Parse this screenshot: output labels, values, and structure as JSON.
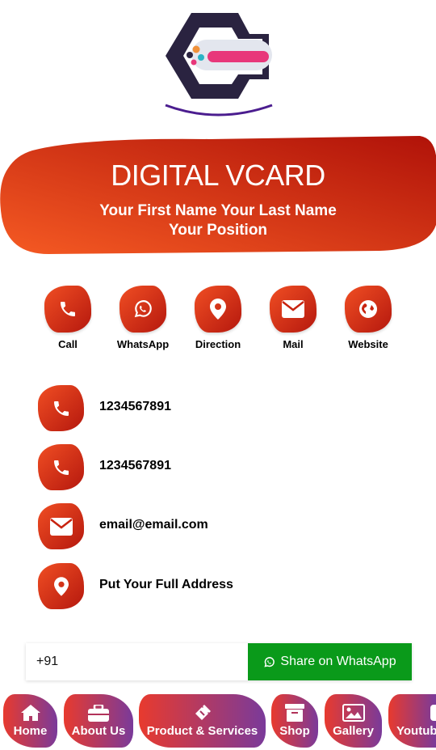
{
  "header": {
    "title": "DIGITAL VCARD",
    "name": "Your First Name Your Last Name",
    "position": "Your Position"
  },
  "quick_actions": [
    {
      "label": "Call",
      "icon": "phone-icon"
    },
    {
      "label": "WhatsApp",
      "icon": "whatsapp-icon"
    },
    {
      "label": "Direction",
      "icon": "map-pin-icon"
    },
    {
      "label": "Mail",
      "icon": "envelope-icon"
    },
    {
      "label": "Website",
      "icon": "globe-icon"
    }
  ],
  "contacts": [
    {
      "text": "1234567891",
      "icon": "phone-icon"
    },
    {
      "text": "1234567891",
      "icon": "phone-icon"
    },
    {
      "text": "email@email.com",
      "icon": "envelope-icon"
    },
    {
      "text": "Put Your Full Address",
      "icon": "map-pin-icon"
    }
  ],
  "share": {
    "phone_value": "+91",
    "button_label": "Share on WhatsApp"
  },
  "nav": [
    {
      "label": "Home",
      "icon": "home-icon"
    },
    {
      "label": "About Us",
      "icon": "briefcase-icon"
    },
    {
      "label": "Product & Services",
      "icon": "ticket-icon"
    },
    {
      "label": "Shop",
      "icon": "box-icon"
    },
    {
      "label": "Gallery",
      "icon": "image-icon"
    },
    {
      "label": "Youtube",
      "icon": "youtube-icon"
    }
  ],
  "colors": {
    "accent_red": "#f04e23",
    "accent_dark_red": "#b5180e",
    "whatsapp_green": "#0a9a1a",
    "nav_purple": "#7a3a9a",
    "logo_navy": "#2a2340",
    "logo_pink": "#e8377a"
  }
}
